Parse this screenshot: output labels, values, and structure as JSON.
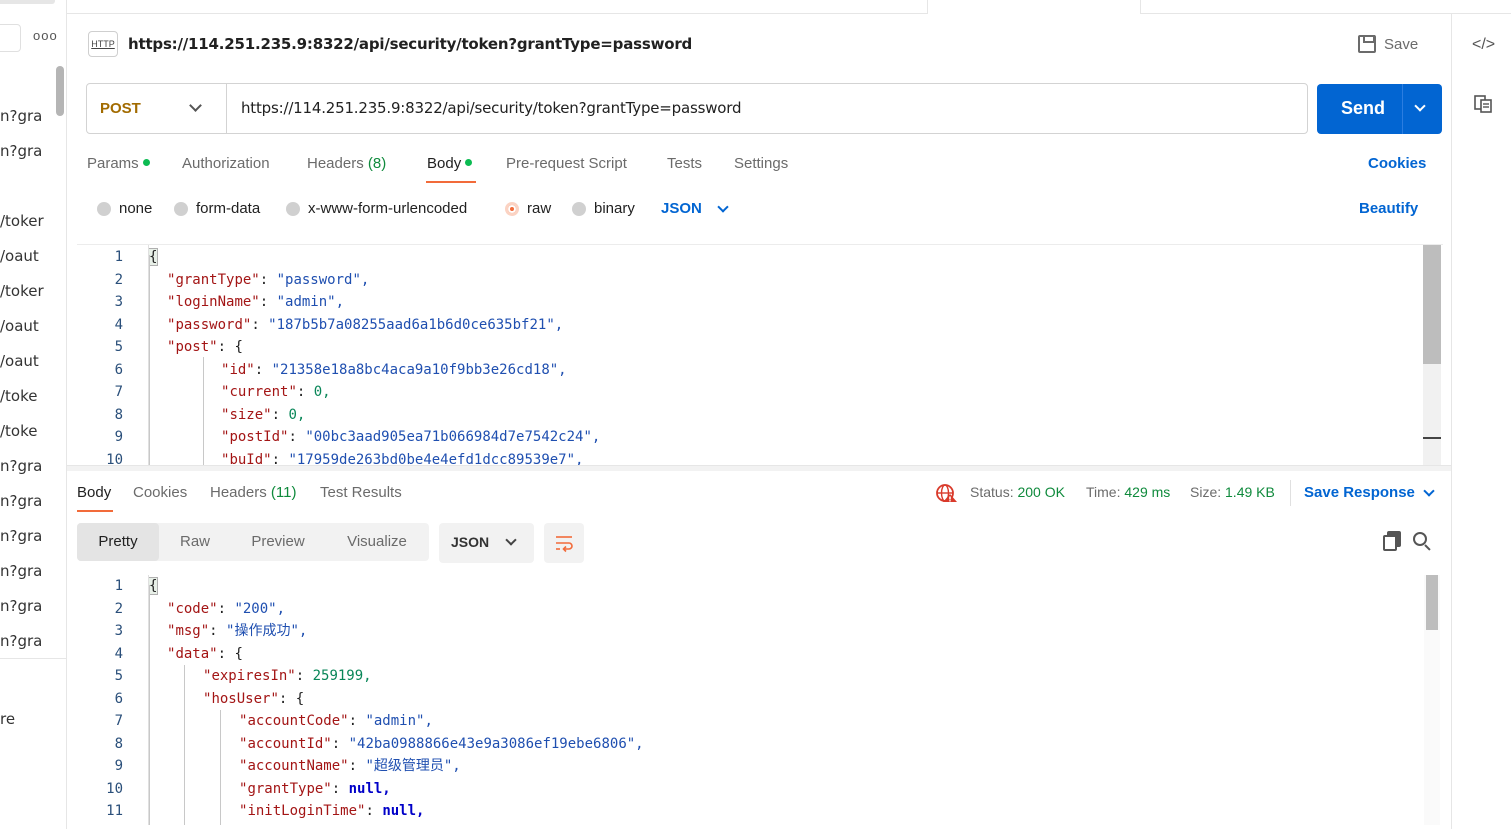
{
  "sidebar": {
    "menu_icon": "more-dots-icon",
    "history": [
      "n?gra",
      "n?gra",
      "/toker",
      "/oaut",
      "/toker",
      "/oaut",
      "/oaut",
      "/toke",
      "/toke",
      "n?gra",
      "n?gra",
      "n?gra",
      "n?gra",
      "n?gra",
      "n?gra",
      "re"
    ]
  },
  "request": {
    "icon_label": "HTTP",
    "title": "https://114.251.235.9:8322/api/security/token?grantType=password",
    "save_label": "Save",
    "method": "POST",
    "url": "https://114.251.235.9:8322/api/security/token?grantType=password",
    "send_label": "Send",
    "tabs": {
      "params": "Params",
      "authorization": "Authorization",
      "headers": "Headers",
      "headers_count": "(8)",
      "body": "Body",
      "prerequest": "Pre-request Script",
      "tests": "Tests",
      "settings": "Settings"
    },
    "cookies_label": "Cookies",
    "body_types": {
      "none": "none",
      "form_data": "form-data",
      "urlencoded": "x-www-form-urlencoded",
      "raw": "raw",
      "binary": "binary"
    },
    "selected_body_type": "raw",
    "format": "JSON",
    "beautify_label": "Beautify",
    "code_lines": [
      {
        "n": "1",
        "indent": 0,
        "key": "",
        "val": "{",
        "vtype": "punct"
      },
      {
        "n": "2",
        "indent": 1,
        "key": "grantType",
        "val": "\"password\",",
        "vtype": "s"
      },
      {
        "n": "3",
        "indent": 1,
        "key": "loginName",
        "val": "\"admin\",",
        "vtype": "s"
      },
      {
        "n": "4",
        "indent": 1,
        "key": "password",
        "val": "\"187b5b7a08255aad6a1b6d0ce635bf21\",",
        "vtype": "s"
      },
      {
        "n": "5",
        "indent": 1,
        "key": "post",
        "val": "{",
        "vtype": "punct"
      },
      {
        "n": "6",
        "indent": 2,
        "key": "id",
        "val": "\"21358e18a8bc4aca9a10f9bb3e26cd18\",",
        "vtype": "s"
      },
      {
        "n": "7",
        "indent": 2,
        "key": "current",
        "val": "0,",
        "vtype": "n"
      },
      {
        "n": "8",
        "indent": 2,
        "key": "size",
        "val": "0,",
        "vtype": "n"
      },
      {
        "n": "9",
        "indent": 2,
        "key": "postId",
        "val": "\"00bc3aad905ea71b066984d7e7542c24\",",
        "vtype": "s"
      },
      {
        "n": "10",
        "indent": 2,
        "key": "buId",
        "val": "\"17959de263bd0be4e4efd1dcc89539e7\",",
        "vtype": "s"
      }
    ]
  },
  "response": {
    "tabs": {
      "body": "Body",
      "cookies": "Cookies",
      "headers": "Headers",
      "headers_count": "(11)",
      "test_results": "Test Results"
    },
    "status_label": "Status:",
    "status_value": "200 OK",
    "time_label": "Time:",
    "time_value": "429 ms",
    "size_label": "Size:",
    "size_value": "1.49 KB",
    "save_response_label": "Save Response",
    "view_tabs": [
      "Pretty",
      "Raw",
      "Preview",
      "Visualize"
    ],
    "active_view": "Pretty",
    "format": "JSON",
    "code_lines": [
      {
        "n": "1",
        "indent": 0,
        "key": "",
        "val": "{",
        "vtype": "punct"
      },
      {
        "n": "2",
        "indent": 1,
        "key": "code",
        "val": "\"200\",",
        "vtype": "s"
      },
      {
        "n": "3",
        "indent": 1,
        "key": "msg",
        "val": "\"操作成功\",",
        "vtype": "s"
      },
      {
        "n": "4",
        "indent": 1,
        "key": "data",
        "val": "{",
        "vtype": "punct"
      },
      {
        "n": "5",
        "indent": 2,
        "key": "expiresIn",
        "val": "259199,",
        "vtype": "n"
      },
      {
        "n": "6",
        "indent": 2,
        "key": "hosUser",
        "val": "{",
        "vtype": "punct"
      },
      {
        "n": "7",
        "indent": 3,
        "key": "accountCode",
        "val": "\"admin\",",
        "vtype": "s"
      },
      {
        "n": "8",
        "indent": 3,
        "key": "accountId",
        "val": "\"42ba0988866e43e9a3086ef19ebe6806\",",
        "vtype": "s"
      },
      {
        "n": "9",
        "indent": 3,
        "key": "accountName",
        "val": "\"超级管理员\",",
        "vtype": "s"
      },
      {
        "n": "10",
        "indent": 3,
        "key": "grantType",
        "val": "null,",
        "vtype": "kw"
      },
      {
        "n": "11",
        "indent": 3,
        "key": "initLoginTime",
        "val": "null,",
        "vtype": "kw"
      }
    ]
  },
  "colors": {
    "accent": "#f26b3a",
    "primary": "#0265d2",
    "success": "#0f8a3c",
    "method_post": "#a26b00"
  },
  "icons": {
    "rail": [
      "code-icon",
      "docs-icon"
    ],
    "response": [
      "globe-error-icon",
      "copy-icon",
      "search-icon",
      "wrap-lines-icon"
    ]
  }
}
